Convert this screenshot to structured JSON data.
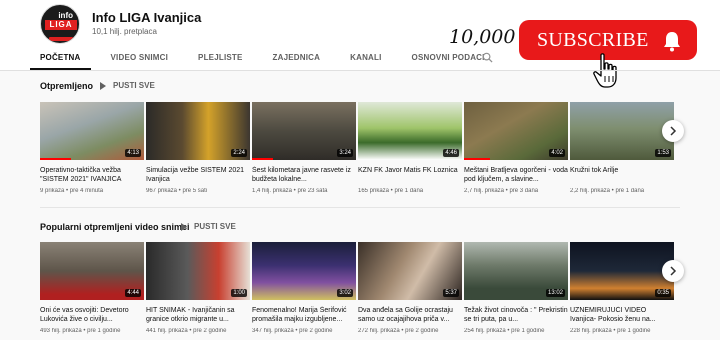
{
  "channel": {
    "avatar_text_top": "info",
    "avatar_text_band": "LIGA",
    "name": "Info LIGA Ivanjica",
    "subscribers": "10,1 hilj. pretplaca"
  },
  "tabs": [
    "POČETNA",
    "VIDEO SNIMCI",
    "PLEJLISTE",
    "ZAJEDNICA",
    "KANALI",
    "OSNOVNI PODACI"
  ],
  "subscribe": {
    "count": "10,000",
    "label": "SUBSCRIBE"
  },
  "sections": [
    {
      "title": "Otpremljeno",
      "play_all": "PUSTI SVE",
      "videos": [
        {
          "title": "Operativno-taktička vežba \"SISTEM 2021\" IVANJICA",
          "meta": "9 prikaza • pre 4 minuta",
          "duration": "4:13",
          "progress": 0.3
        },
        {
          "title": "Simulacija vežbe SISTEM 2021 Ivanjica",
          "meta": "967 prikaza • pre 5 sati",
          "duration": "2:24",
          "progress": 0
        },
        {
          "title": "Šest kilometara javne rasvete iz budžeta lokalne...",
          "meta": "1,4 hilj. prikaza • pre 23 sata",
          "duration": "3:24",
          "progress": 0.2
        },
        {
          "title": "KZN FK Javor Matis FK Loznica",
          "meta": "165 prikaza • pre 1 dana",
          "duration": "4:46",
          "progress": 0
        },
        {
          "title": "Meštani Bratljeva ogorčeni - voda pod ključem, a slavine...",
          "meta": "2,7 hilj. prikaza • pre 3 dana",
          "duration": "4:02",
          "progress": 0.25
        },
        {
          "title": "Kružni tok Arilje",
          "meta": "2,2 hilj. prikaza • pre 1 dana",
          "duration": "1:53",
          "progress": 0
        }
      ]
    },
    {
      "title": "Popularni otpremljeni video snimci",
      "play_all": "PUSTI SVE",
      "videos": [
        {
          "title": "Oni će vas osvojiti: Devetoro Lukovića žive o civilju...",
          "meta": "493 hilj. prikaza • pre 1 godine",
          "duration": "4:44",
          "progress": 0
        },
        {
          "title": "HIT SNIMAK - Ivanjičanin sa granice otkrio migrante u...",
          "meta": "441 hilj. prikaza • pre 2 godine",
          "duration": "1:00",
          "progress": 0
        },
        {
          "title": "Fenomenalno! Marija Šerifović promašila majku izgubljene...",
          "meta": "347 hilj. prikaza • pre 2 godine",
          "duration": "3:02",
          "progress": 0
        },
        {
          "title": "Dva anđela sa Golije ocrastaju samo uz ocajajihova priča v...",
          "meta": "272 hilj. prikaza • pre 2 godine",
          "duration": "5:37",
          "progress": 0
        },
        {
          "title": "Težak život cinovoča : \" Prekristin se tri puta, pa u...",
          "meta": "254 hilj. prikaza • pre 1 godine",
          "duration": "13:02",
          "progress": 0
        },
        {
          "title": "UZNEMIRUJUĆI VIDEO Ivanjica- Pokosio ženu na...",
          "meta": "228 hilj. prikaza • pre 1 godine",
          "duration": "0:35",
          "progress": 0
        }
      ]
    }
  ],
  "colors": {
    "subscribe_red": "#e8191a",
    "progress_red": "#ff0000",
    "meta_gray": "#606060"
  },
  "icons": [
    "search-icon",
    "bell-icon",
    "hand-cursor-icon",
    "play-all-icon",
    "chevron-right-icon"
  ]
}
